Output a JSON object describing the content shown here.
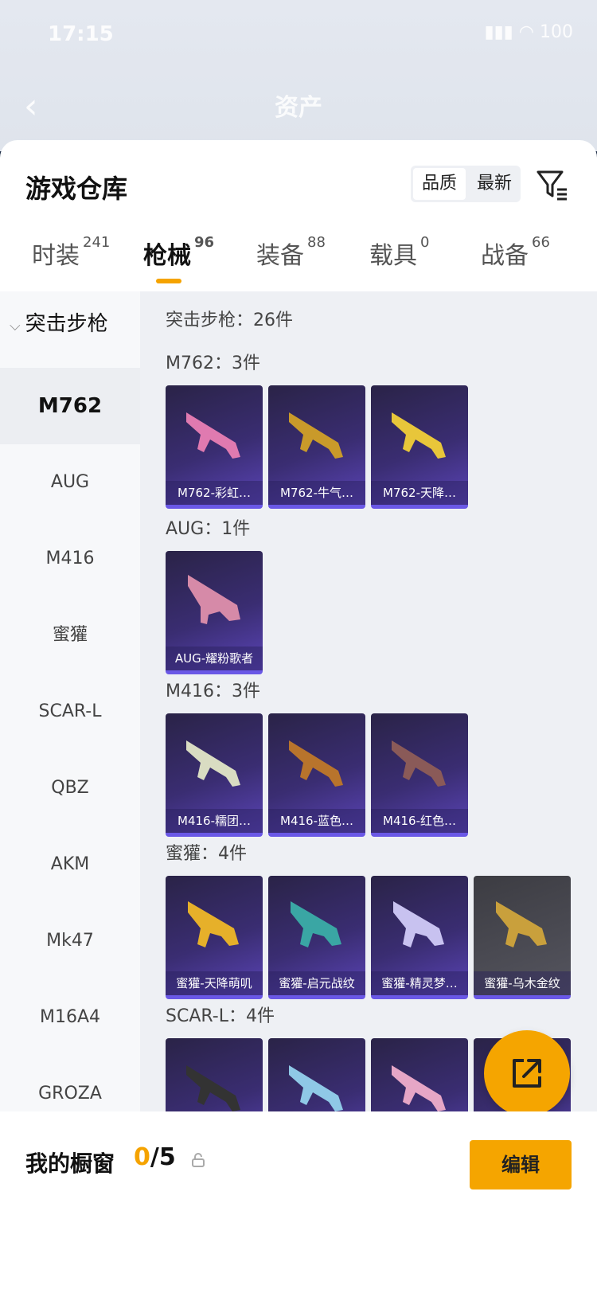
{
  "status_bar": {
    "time": "17:15",
    "battery": "100"
  },
  "nav": {
    "title": "资产"
  },
  "sheet": {
    "title": "游戏仓库",
    "sort": {
      "options": [
        "品质",
        "最新"
      ],
      "active": "品质"
    }
  },
  "tabs": [
    {
      "label": "时装",
      "count": "241"
    },
    {
      "label": "枪械",
      "count": "96"
    },
    {
      "label": "装备",
      "count": "88"
    },
    {
      "label": "载具",
      "count": "0"
    },
    {
      "label": "战备",
      "count": "66"
    }
  ],
  "sidebar": {
    "group": "突击步枪",
    "items": [
      "M762",
      "AUG",
      "M416",
      "蜜獾",
      "SCAR-L",
      "QBZ",
      "AKM",
      "Mk47",
      "M16A4",
      "GROZA"
    ],
    "selected": "M762"
  },
  "content": {
    "summary": "突击步枪：26件",
    "sections": [
      {
        "title": "M762：3件",
        "items": [
          "M762-彩虹…",
          "M762-牛气…",
          "M762-天降…"
        ]
      },
      {
        "title": "AUG：1件",
        "items": [
          "AUG-耀粉歌者"
        ]
      },
      {
        "title": "M416：3件",
        "items": [
          "M416-糯团…",
          "M416-蓝色…",
          "M416-红色…"
        ]
      },
      {
        "title": "蜜獾：4件",
        "items": [
          "蜜獾-天降萌叽",
          "蜜獾-启元战纹",
          "蜜獾-精灵梦…",
          "蜜獾-乌木金纹"
        ]
      },
      {
        "title": "SCAR-L：4件",
        "items": [
          "",
          "",
          "",
          ""
        ]
      }
    ]
  },
  "bottom": {
    "title": "我的橱窗",
    "used": "0",
    "total": "/5",
    "edit_label": "编辑"
  },
  "colors": {
    "accent": "#f5a500",
    "card_purple": "#3a2d72"
  }
}
